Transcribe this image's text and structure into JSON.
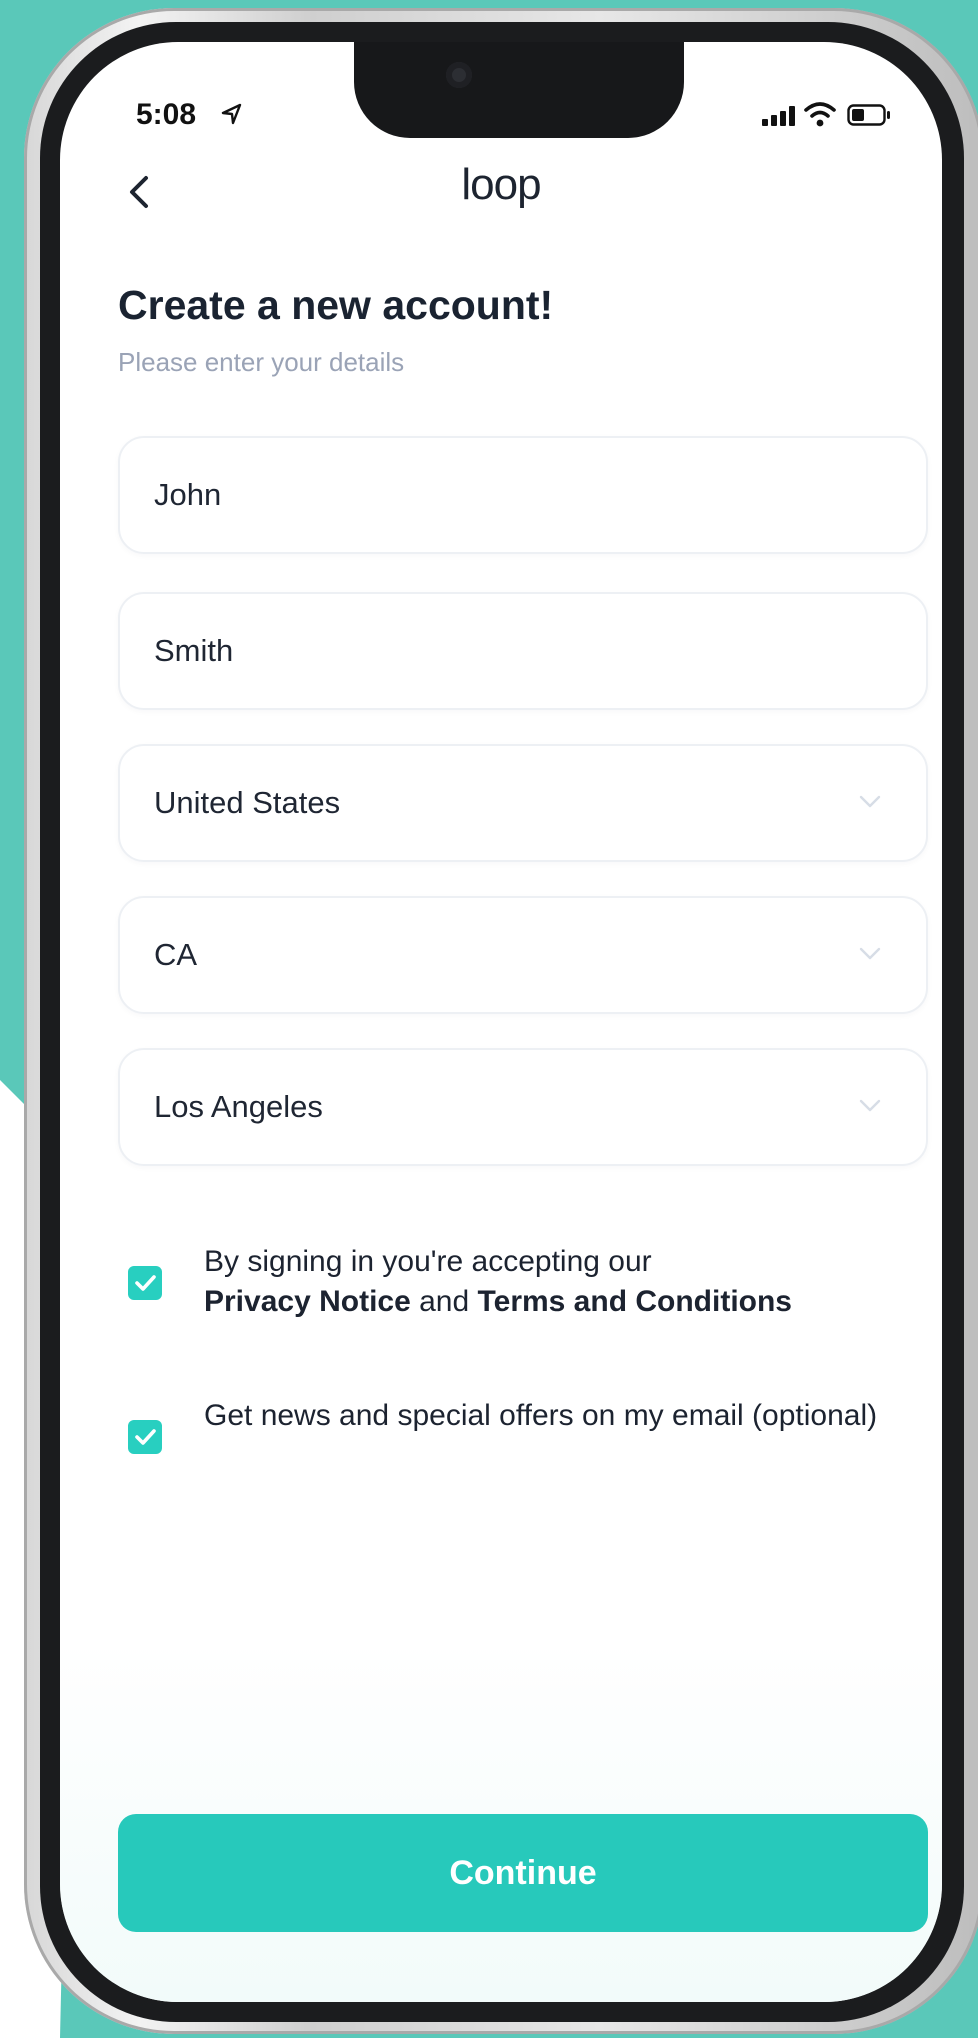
{
  "status_bar": {
    "time": "5:08"
  },
  "header": {
    "logo": "loop"
  },
  "form": {
    "title": "Create a new account!",
    "subtitle": "Please enter your details",
    "fields": [
      {
        "value": "John",
        "type": "text"
      },
      {
        "value": "Smith",
        "type": "text"
      },
      {
        "value": "United States",
        "type": "select"
      },
      {
        "value": "CA",
        "type": "select"
      },
      {
        "value": "Los Angeles",
        "type": "select"
      }
    ]
  },
  "consents": [
    {
      "checked": true,
      "text_prefix": "By signing in you're accepting our",
      "link1": "Privacy Notice",
      "middle": "and",
      "link2": "Terms and Conditions"
    },
    {
      "checked": true,
      "text": "Get news and special offers on my email (optional)"
    }
  ],
  "actions": {
    "continue_label": "Continue"
  },
  "colors": {
    "accent": "#27c9bb",
    "checkbox": "#28cfc0",
    "background_teal": "#5ac8b9",
    "title_text": "#1a2331",
    "subtitle_text": "#9aa3b6"
  },
  "icons": {
    "back": "chevron-left-icon",
    "location": "location-arrow-icon",
    "signal": "signal-icon",
    "wifi": "wifi-icon",
    "battery": "battery-icon",
    "dropdown": "chevron-down-icon",
    "checkbox": "checkmark-icon"
  }
}
